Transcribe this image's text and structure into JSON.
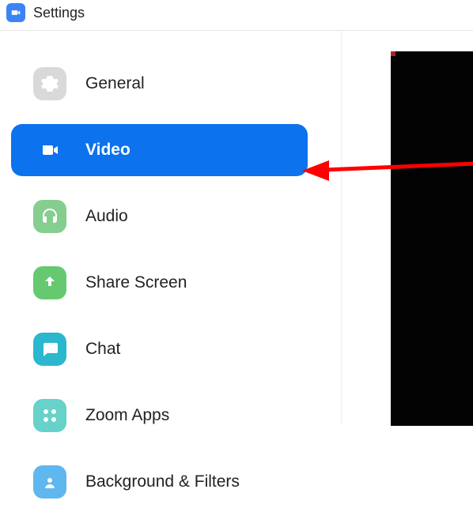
{
  "header": {
    "title": "Settings"
  },
  "sidebar": {
    "items": [
      {
        "label": "General"
      },
      {
        "label": "Video"
      },
      {
        "label": "Audio"
      },
      {
        "label": "Share Screen"
      },
      {
        "label": "Chat"
      },
      {
        "label": "Zoom Apps"
      },
      {
        "label": "Background & Filters"
      }
    ]
  }
}
